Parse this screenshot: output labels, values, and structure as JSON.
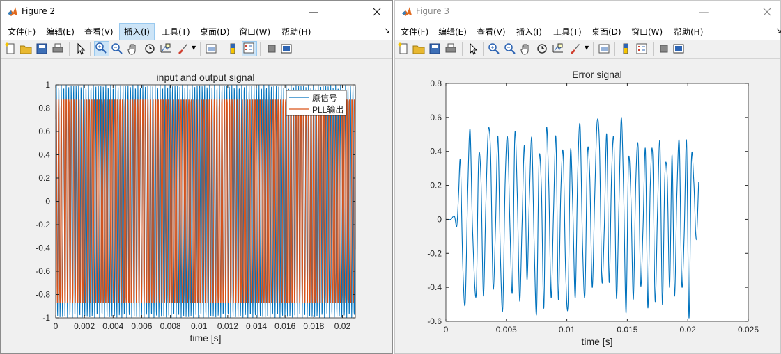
{
  "windows": [
    {
      "title": "Figure 2",
      "menu": [
        "文件(F)",
        "编辑(E)",
        "查看(V)",
        "插入(I)",
        "工具(T)",
        "桌面(D)",
        "窗口(W)",
        "帮助(H)"
      ],
      "chart_data": {
        "type": "line",
        "title": "input and output signal",
        "xlabel": "time [s]",
        "ylabel": "",
        "xlim": [
          0,
          0.0209
        ],
        "ylim": [
          -1,
          1
        ],
        "xticks": [
          "0",
          "0.002",
          "0.004",
          "0.006",
          "0.008",
          "0.01",
          "0.012",
          "0.014",
          "0.016",
          "0.018",
          "0.02"
        ],
        "yticks": [
          "-1",
          "-0.8",
          "-0.6",
          "-0.4",
          "-0.2",
          "0",
          "0.2",
          "0.4",
          "0.6",
          "0.8",
          "1"
        ],
        "grid": false,
        "legend_position": "top-right",
        "series": [
          {
            "name": "原信号",
            "color": "#0072bd",
            "description": "sinusoid, amplitude 1, approx 120 cycles over 0-0.0209 s"
          },
          {
            "name": "PLL输出",
            "color": "#d95319",
            "description": "square-like oscillation between -0.87 and 0.87 tracking the input"
          }
        ]
      }
    },
    {
      "title": "Figure 3",
      "menu": [
        "文件(F)",
        "编辑(E)",
        "查看(V)",
        "插入(I)",
        "工具(T)",
        "桌面(D)",
        "窗口(W)",
        "帮助(H)"
      ],
      "chart_data": {
        "type": "line",
        "title": "Error signal",
        "xlabel": "time [s]",
        "ylabel": "",
        "xlim": [
          0,
          0.025
        ],
        "ylim": [
          -0.6,
          0.8
        ],
        "xticks": [
          "0",
          "0.005",
          "0.01",
          "0.015",
          "0.02",
          "0.025"
        ],
        "yticks": [
          "-0.6",
          "-0.4",
          "-0.2",
          "0",
          "0.2",
          "0.4",
          "0.6",
          "0.8"
        ],
        "grid": false,
        "series": [
          {
            "name": "",
            "color": "#0072bd",
            "x": [
              0,
              0.0004,
              0.0007,
              0.0009,
              0.00105,
              0.0012,
              0.0014,
              0.0016,
              0.0018,
              0.002,
              0.0022,
              0.0025,
              0.0027,
              0.0029,
              0.0031,
              0.0033,
              0.0035,
              0.0037,
              0.0039,
              0.0041,
              0.0043,
              0.0045,
              0.0047,
              0.0049,
              0.0051,
              0.0053,
              0.0055,
              0.0057,
              0.0059,
              0.0061,
              0.0063,
              0.0065,
              0.0067,
              0.0069,
              0.0071,
              0.0073,
              0.0075,
              0.0077,
              0.0079,
              0.0081,
              0.0083,
              0.0085,
              0.0087,
              0.0089,
              0.0091,
              0.0093,
              0.0095,
              0.0097,
              0.0099,
              0.0101,
              0.0103,
              0.0105,
              0.0107,
              0.0109,
              0.0111,
              0.0113,
              0.0115,
              0.0117,
              0.0119,
              0.0121,
              0.0123,
              0.0125,
              0.0127,
              0.0129,
              0.0131,
              0.0133,
              0.0135,
              0.0137,
              0.0139,
              0.0141,
              0.0143,
              0.0145,
              0.0147,
              0.0149,
              0.0151,
              0.0153,
              0.0155,
              0.0157,
              0.0159,
              0.0161,
              0.0163,
              0.0165,
              0.0167,
              0.0169,
              0.0171,
              0.0173,
              0.0175,
              0.0177,
              0.0179,
              0.0181,
              0.0183,
              0.0185,
              0.0187,
              0.0189,
              0.0191,
              0.0193,
              0.0195,
              0.0197,
              0.0199,
              0.0201,
              0.0203,
              0.0205,
              0.0207,
              0.0209
            ],
            "y": [
              0,
              0.0,
              0.02,
              -0.04,
              0.15,
              0.34,
              -0.28,
              -0.49,
              0.15,
              0.53,
              -0.05,
              -0.45,
              0.34,
              0.24,
              -0.45,
              0.08,
              0.52,
              0.38,
              -0.4,
              -0.05,
              0.49,
              -0.2,
              -0.53,
              0.22,
              0.48,
              -0.05,
              -0.42,
              0.5,
              0.15,
              -0.48,
              -0.02,
              0.43,
              -0.35,
              0.12,
              0.48,
              -0.15,
              -0.55,
              0.34,
              0.18,
              -0.52,
              0.51,
              0.22,
              -0.46,
              0.04,
              0.48,
              -0.47,
              0.16,
              0.39,
              -0.3,
              -0.5,
              0.4,
              0.05,
              -0.46,
              0.27,
              0.55,
              -0.15,
              -0.44,
              0.38,
              0.25,
              -0.4,
              0.12,
              0.57,
              0.43,
              -0.36,
              -0.05,
              0.5,
              -0.37,
              0.26,
              0.45,
              -0.46,
              0.06,
              0.6,
              0.15,
              -0.55,
              0.34,
              0.12,
              -0.47,
              0.22,
              0.42,
              -0.38,
              -0.05,
              0.41,
              -0.52,
              0.2,
              0.38,
              -0.48,
              0.05,
              0.45,
              -0.5,
              0.25,
              0.25,
              -0.4,
              0.38,
              -0.45,
              0.15,
              0.45,
              -0.38,
              -0.1,
              0.46,
              -0.58,
              0.35,
              0.22,
              -0.12,
              0.22
            ]
          }
        ]
      }
    }
  ]
}
